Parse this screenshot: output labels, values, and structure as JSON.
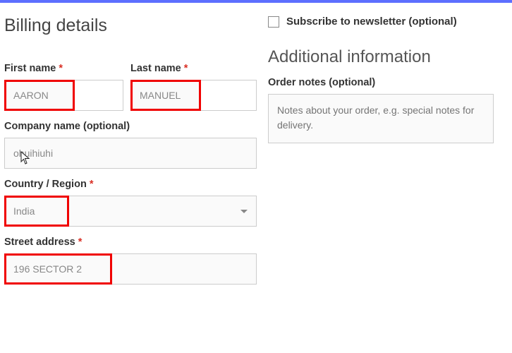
{
  "billing": {
    "title": "Billing details",
    "first_name": {
      "label": "First name",
      "value": "AARON"
    },
    "last_name": {
      "label": "Last name",
      "value": "MANUEL"
    },
    "company": {
      "label": "Company name (optional)",
      "value": "ohuihiuhi"
    },
    "country": {
      "label": "Country / Region",
      "value": "India"
    },
    "street": {
      "label": "Street address",
      "value": "196 SECTOR 2"
    }
  },
  "newsletter": {
    "label": "Subscribe to newsletter (optional)"
  },
  "additional": {
    "title": "Additional information",
    "order_notes": {
      "label": "Order notes (optional)",
      "placeholder": "Notes about your order, e.g. special notes for delivery."
    }
  },
  "required_marker": "*"
}
